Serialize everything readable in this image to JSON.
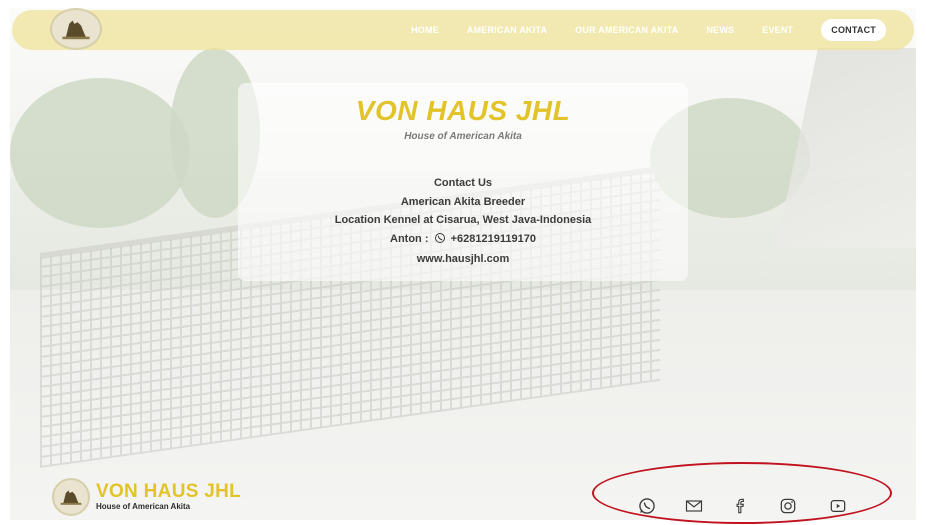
{
  "nav": {
    "items": [
      {
        "label": "HOME"
      },
      {
        "label": "AMERICAN AKITA"
      },
      {
        "label": "OUR AMERICAN AKITA"
      },
      {
        "label": "NEWS"
      },
      {
        "label": "EVENT"
      },
      {
        "label": "CONTACT",
        "active": true
      }
    ]
  },
  "card": {
    "title": "VON HAUS JHL",
    "subtitle": "House of American Akita",
    "contact_heading": "Contact Us",
    "breeder": "American Akita Breeder",
    "location": "Location Kennel at Cisarua, West Java-Indonesia",
    "phone_name": "Anton :",
    "phone_number": "+6281219119170",
    "website": "www.hausjhl.com"
  },
  "footer": {
    "brand_title": "VON HAUS JHL",
    "brand_subtitle": "House of American Akita",
    "social_icons": [
      "whatsapp-icon",
      "mail-icon",
      "facebook-icon",
      "instagram-icon",
      "youtube-icon"
    ]
  },
  "colors": {
    "brand_gold": "#e2c42a",
    "nav_bg": "#eee296",
    "annotation_red": "#c1121f"
  }
}
